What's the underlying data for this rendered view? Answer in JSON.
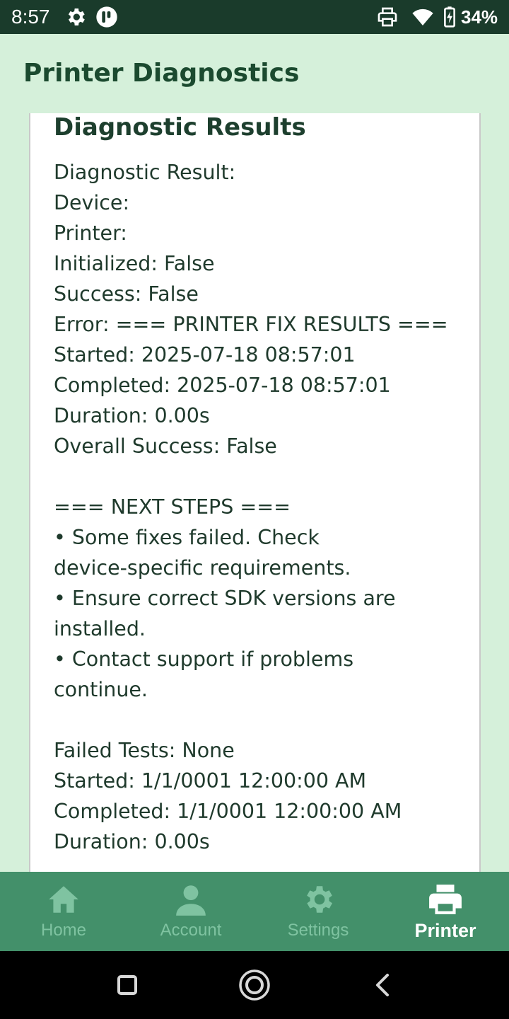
{
  "status_bar": {
    "time": "8:57",
    "battery": "34%",
    "icons": [
      "gear-icon",
      "app-logo-icon",
      "printer-icon",
      "wifi-icon",
      "battery-charging-icon"
    ]
  },
  "header": {
    "title": "Printer Diagnostics"
  },
  "card": {
    "title": "Diagnostic Results",
    "lines": [
      "Diagnostic Result:",
      "Device:",
      "Printer:",
      "Initialized: False",
      "Success: False",
      "Error: === PRINTER FIX RESULTS ===",
      "Started: 2025-07-18 08:57:01",
      "Completed: 2025-07-18 08:57:01",
      "Duration: 0.00s",
      "Overall Success: False",
      "",
      "=== NEXT STEPS ===",
      "• Some fixes failed. Check",
      "device-specific requirements.",
      "• Ensure correct SDK versions are",
      "installed.",
      "• Contact support if problems",
      "continue.",
      "",
      "Failed Tests: None",
      "Started: 1/1/0001 12:00:00 AM",
      "Completed: 1/1/0001 12:00:00 AM",
      "Duration: 0.00s"
    ]
  },
  "bottom_nav": {
    "items": [
      {
        "label": "Home",
        "icon": "home-icon",
        "active": false
      },
      {
        "label": "Account",
        "icon": "account-icon",
        "active": false
      },
      {
        "label": "Settings",
        "icon": "settings-gear-icon",
        "active": false
      },
      {
        "label": "Printer",
        "icon": "printer-icon",
        "active": true
      }
    ]
  },
  "colors": {
    "status_bar": "#1a3b2b",
    "page_background": "#d5f0da",
    "title": "#1b4a2f",
    "nav_background": "#43906a",
    "nav_inactive": "#7fc3a1",
    "nav_active": "#ffffff"
  }
}
